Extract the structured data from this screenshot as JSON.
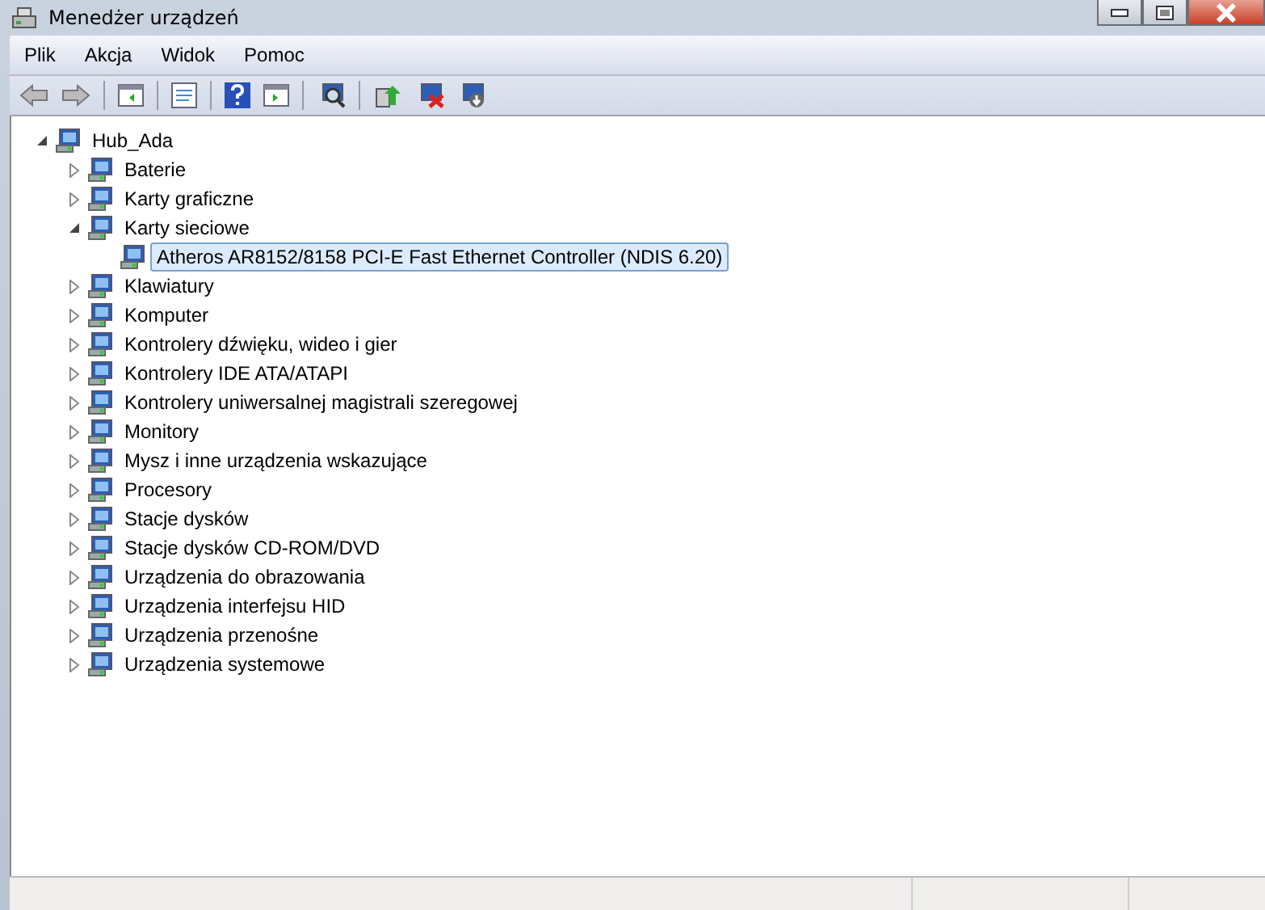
{
  "window": {
    "title": "Menedżer urządzeń"
  },
  "menu": [
    "Plik",
    "Akcja",
    "Widok",
    "Pomoc"
  ],
  "tree": [
    {
      "label": "Hub_Ada",
      "expanded": true,
      "selected": false,
      "children": [
        {
          "label": "Baterie",
          "expanded": false,
          "selected": false
        },
        {
          "label": "Karty graficzne",
          "expanded": false,
          "selected": false
        },
        {
          "label": "Karty sieciowe",
          "expanded": true,
          "selected": false,
          "children": [
            {
              "label": "Atheros AR8152/8158 PCI-E Fast Ethernet Controller (NDIS 6.20)",
              "selected": true
            }
          ]
        },
        {
          "label": "Klawiatury",
          "expanded": false,
          "selected": false
        },
        {
          "label": "Komputer",
          "expanded": false,
          "selected": false
        },
        {
          "label": "Kontrolery dźwięku, wideo i gier",
          "expanded": false,
          "selected": false
        },
        {
          "label": "Kontrolery IDE ATA/ATAPI",
          "expanded": false,
          "selected": false
        },
        {
          "label": "Kontrolery uniwersalnej magistrali szeregowej",
          "expanded": false,
          "selected": false
        },
        {
          "label": "Monitory",
          "expanded": false,
          "selected": false
        },
        {
          "label": "Mysz i inne urządzenia wskazujące",
          "expanded": false,
          "selected": false
        },
        {
          "label": "Procesory",
          "expanded": false,
          "selected": false
        },
        {
          "label": "Stacje dysków",
          "expanded": false,
          "selected": false
        },
        {
          "label": "Stacje dysków CD-ROM/DVD",
          "expanded": false,
          "selected": false
        },
        {
          "label": "Urządzenia do obrazowania",
          "expanded": false,
          "selected": false
        },
        {
          "label": "Urządzenia interfejsu HID",
          "expanded": false,
          "selected": false
        },
        {
          "label": "Urządzenia przenośne",
          "expanded": false,
          "selected": false
        },
        {
          "label": "Urządzenia systemowe",
          "expanded": false,
          "selected": false
        }
      ]
    }
  ]
}
